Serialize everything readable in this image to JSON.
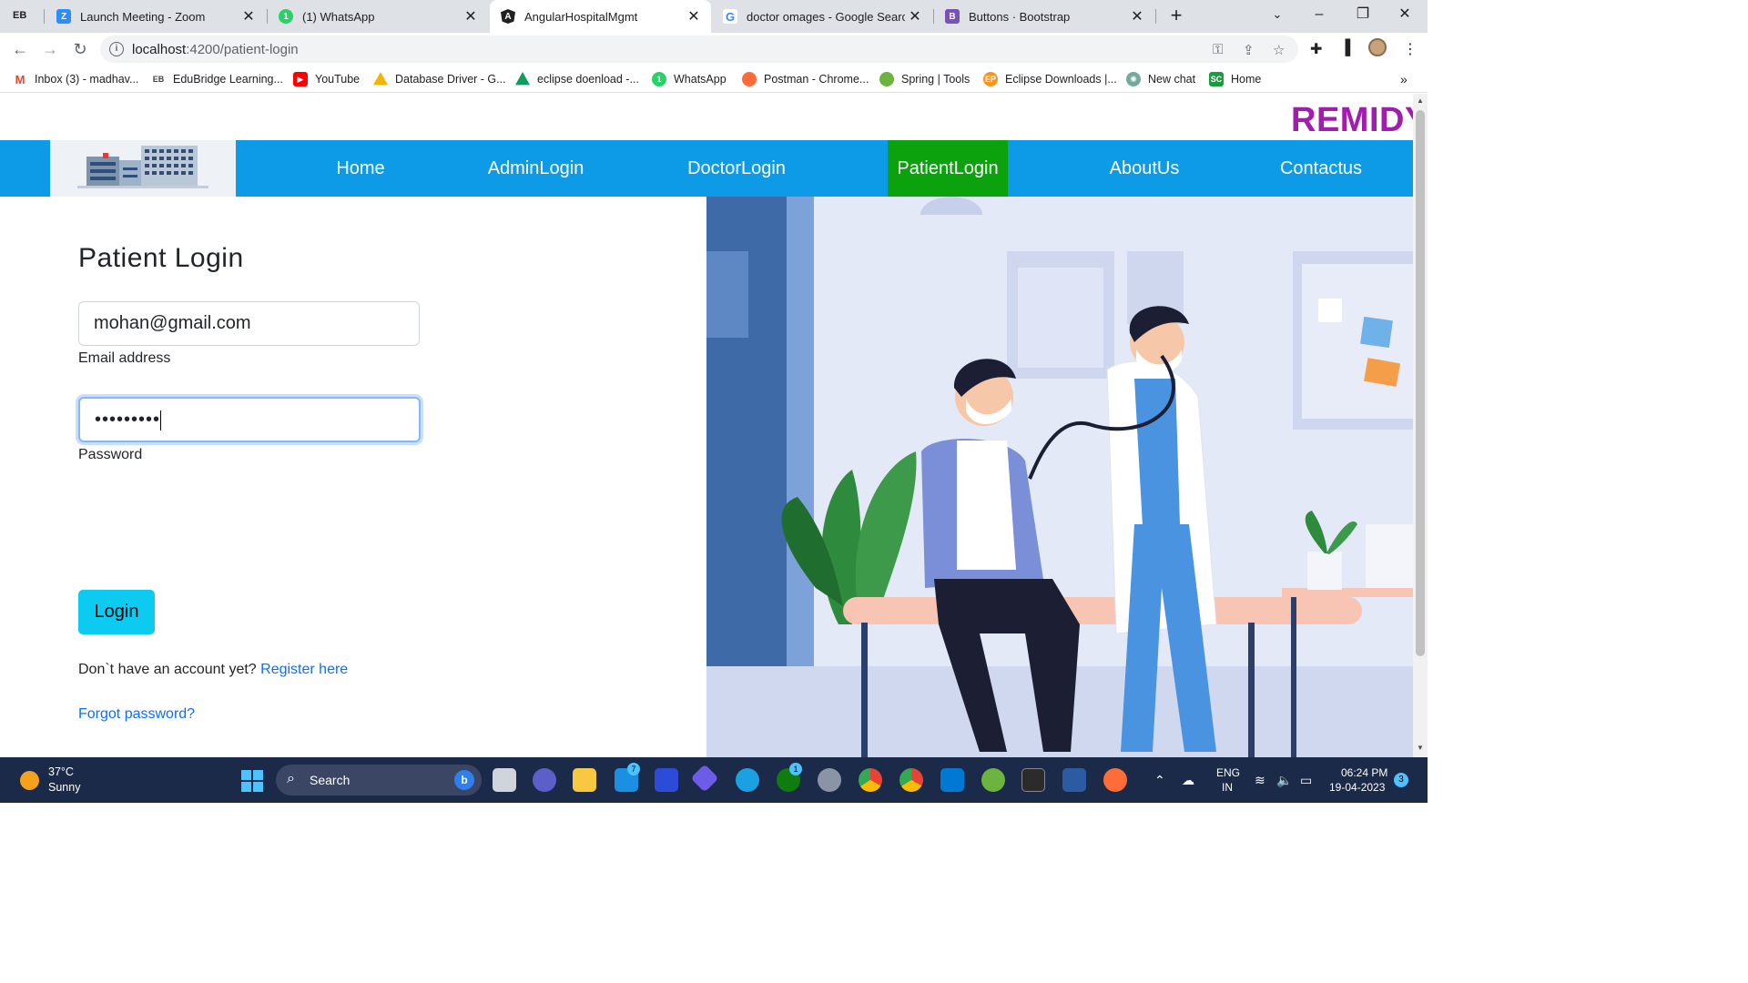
{
  "browser": {
    "tabs": [
      {
        "title": "Launch Meeting - Zoom",
        "icon": "zoom-icon",
        "color": "#2d8cff"
      },
      {
        "title": "(1) WhatsApp",
        "icon": "whatsapp-icon",
        "color": "#25d366"
      },
      {
        "title": "AngularHospitalMgmt",
        "icon": "angular-icon",
        "color": "#202124"
      },
      {
        "title": "doctor omages - Google Search",
        "icon": "google-icon",
        "color": "#4285f4"
      },
      {
        "title": "Buttons · Bootstrap",
        "icon": "bootstrap-icon",
        "color": "#7952b3"
      }
    ],
    "url_host": "localhost",
    "url_path": ":4200/patient-login",
    "bookmarks": [
      {
        "label": "Inbox (3) - madhav...",
        "icon": "gmail-icon",
        "color": "#ea4335"
      },
      {
        "label": "EduBridge Learning...",
        "icon": "edubridge-icon",
        "color": "#444444"
      },
      {
        "label": "YouTube",
        "icon": "youtube-icon",
        "color": "#ff0000"
      },
      {
        "label": "Database Driver - G...",
        "icon": "drive-icon",
        "color": "#f4b400"
      },
      {
        "label": "eclipse doenload -...",
        "icon": "drive-icon",
        "color": "#0f9d58"
      },
      {
        "label": "WhatsApp",
        "icon": "whatsapp-icon",
        "color": "#25d366"
      },
      {
        "label": "Postman - Chrome...",
        "icon": "postman-icon",
        "color": "#ff6c37"
      },
      {
        "label": "Spring | Tools",
        "icon": "spring-icon",
        "color": "#6db33f"
      },
      {
        "label": "Eclipse Downloads |...",
        "icon": "eclipse-icon",
        "color": "#f7941e"
      },
      {
        "label": "New chat",
        "icon": "chatgpt-icon",
        "color": "#74aa9c"
      },
      {
        "label": "Home",
        "icon": "home-sc-icon",
        "color": "#1a9c3e"
      }
    ]
  },
  "site": {
    "brand": "REMIDY",
    "nav": [
      "Home",
      "AdminLogin",
      "DoctorLogin",
      "PatientLogin",
      "AboutUs",
      "Contactus"
    ],
    "nav_active": "PatientLogin"
  },
  "login": {
    "title": "Patient Login",
    "email_value": "mohan@gmail.com",
    "email_label": "Email address",
    "password_value": "•••••••••",
    "password_label": "Password",
    "button": "Login",
    "register_prompt": "Don`t have an account yet?",
    "register_link": "Register here",
    "forgot_link": "Forgot password?"
  },
  "taskbar": {
    "temperature": "37°C",
    "weather": "Sunny",
    "search_placeholder": "Search",
    "lang_top": "ENG",
    "lang_bottom": "IN",
    "time": "06:24 PM",
    "date": "19-04-2023",
    "notifications": "3",
    "mail_badge": "7",
    "xbox_badge": "1"
  },
  "colors": {
    "navbar": "#0d9be8",
    "nav_active": "#0ca20e",
    "brand": "#a21caf",
    "login_button": "#0dcaf0",
    "link": "#0d6efd"
  }
}
